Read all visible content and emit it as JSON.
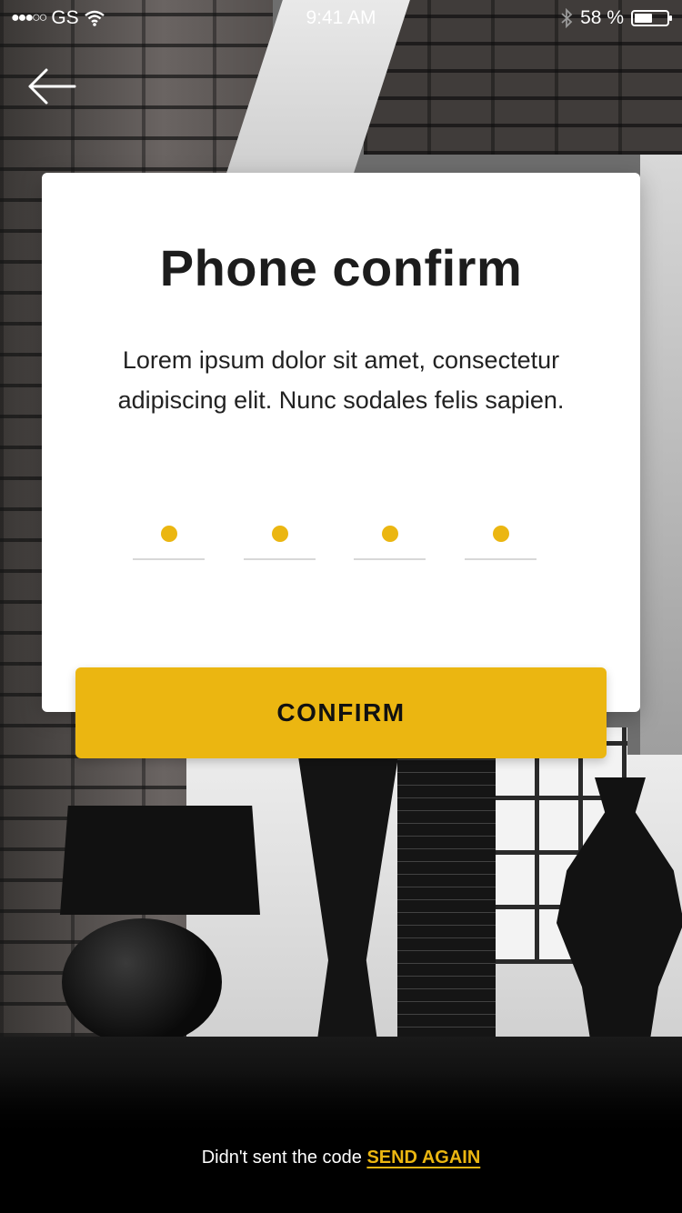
{
  "status_bar": {
    "signal_dots": "●●●○○",
    "carrier": "GS",
    "time": "9:41 AM",
    "battery_percent": "58 %",
    "battery_level": 0.58,
    "icons": [
      "wifi-icon",
      "bluetooth-icon",
      "battery-icon"
    ]
  },
  "nav": {
    "back_icon": "back-arrow-icon"
  },
  "card": {
    "title": "Phone confirm",
    "description": "Lorem ipsum dolor sit amet, consectetur adipiscing elit. Nunc sodales felis sapien."
  },
  "code_input": {
    "digits": [
      "●",
      "●",
      "●",
      "●"
    ],
    "length": 4
  },
  "confirm_button": {
    "label": "CONFIRM"
  },
  "footer": {
    "prompt": "Didn't sent the code",
    "link": "SEND AGAIN"
  },
  "colors": {
    "accent": "#ebb611",
    "card_bg": "#ffffff",
    "text_dark": "#1c1c1c"
  }
}
